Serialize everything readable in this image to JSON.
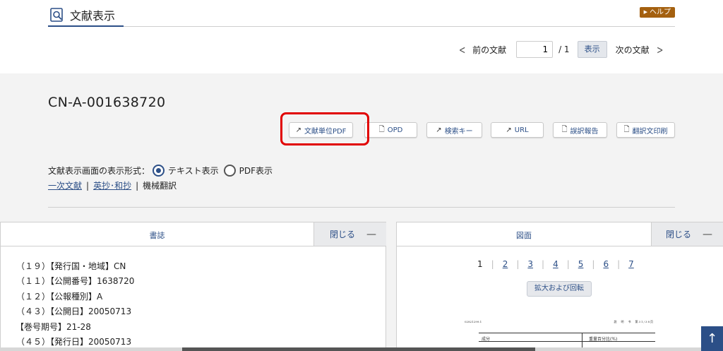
{
  "header": {
    "title": "文献表示",
    "help_label": "ヘルプ",
    "help_arrow": "▶"
  },
  "pager": {
    "prev_label": "前の文献",
    "next_label": "次の文献",
    "current_page": "1",
    "total": "/ 1",
    "show_label": "表示",
    "prev_chevron": "<",
    "next_chevron": ">"
  },
  "document": {
    "id": "CN-A-001638720"
  },
  "actions": [
    {
      "label": "文献単位PDF",
      "icon": "external-link-icon",
      "glyph": "↗"
    },
    {
      "label": "OPD",
      "icon": "document-icon",
      "glyph": "🗋"
    },
    {
      "label": "検索キー",
      "icon": "external-link-icon",
      "glyph": "↗"
    },
    {
      "label": "URL",
      "icon": "external-link-icon",
      "glyph": "↗"
    },
    {
      "label": "誤訳報告",
      "icon": "document-icon",
      "glyph": "🗋"
    },
    {
      "label": "翻訳文印刷",
      "icon": "document-icon",
      "glyph": "🗋"
    }
  ],
  "display_format": {
    "label": "文献表示画面の表示形式：",
    "option_text": "テキスト表示",
    "option_pdf": "PDF表示",
    "selected": "テキスト表示"
  },
  "doc_links": {
    "primary": "一次文献",
    "abstract": "英抄･和抄",
    "sep": "|",
    "machine": "機械翻訳"
  },
  "biblio_panel": {
    "title": "書誌",
    "close_label": "閉じる",
    "minimize": "—",
    "lines": [
      "（１９）【発行国・地域】CN",
      "（１１）【公開番号】1638720",
      "（１２）【公報種別】A",
      "（４３）【公開日】20050713",
      "【巻号期号】21-28",
      "（４５）【発行日】20050713"
    ]
  },
  "figure_panel": {
    "title": "図面",
    "close_label": "閉じる",
    "minimize": "—",
    "pages": [
      "1",
      "2",
      "3",
      "4",
      "5",
      "6",
      "7"
    ],
    "current_page": "1",
    "zoom_label": "拡大および回転",
    "thumb": {
      "header_left": "02821299.1",
      "header_right": "説　明　书　第31/38页",
      "col1": "成分",
      "col2": "重量百分比(%)"
    }
  },
  "scroll_top_icon": "↑"
}
